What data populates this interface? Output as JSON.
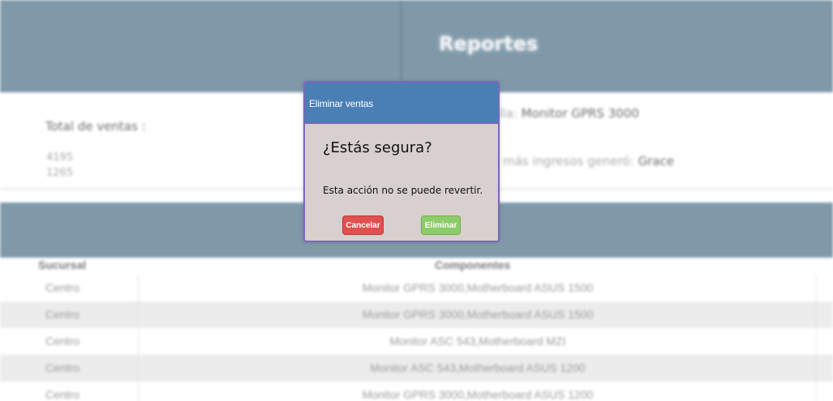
{
  "header": {
    "title": "Reportes"
  },
  "stats": {
    "total_label": "Total de ventas :",
    "totals": [
      "4195",
      "1265"
    ],
    "star_prefix": "ella:",
    "star_product": "Monitor GPRS 3000",
    "top_seller_prefix": "e más ingresos generó:",
    "top_seller_name": "Grace"
  },
  "table": {
    "columns": [
      "Sucursal",
      "Componentes"
    ],
    "rows": [
      {
        "sucursal": "Centro",
        "componentes": "Monitor GPRS 3000,Motherboard ASUS 1500"
      },
      {
        "sucursal": "Centro",
        "componentes": "Monitor GPRS 3000,Motherboard ASUS 1500"
      },
      {
        "sucursal": "Centro",
        "componentes": "Monitor ASC 543,Motherboard MZI"
      },
      {
        "sucursal": "Centro",
        "componentes": "Monitor ASC 543,Motherboard ASUS 1200"
      },
      {
        "sucursal": "Centro",
        "componentes": "Monitor GPRS 3000,Motherboard ASUS 1200"
      }
    ]
  },
  "modal": {
    "title": "Eliminar ventas",
    "question": "¿Estás segura?",
    "message": "Esta acción no se puede revertir.",
    "cancel_label": "Cancelar",
    "confirm_label": "Eliminar"
  },
  "colors": {
    "header_bg": "#7f99a9",
    "modal_header_bg": "#4a7fb5",
    "modal_body_bg": "#d8cfcf",
    "modal_border": "#7b68b8",
    "cancel_button": "#e14f4f",
    "confirm_button": "#8ecb6a"
  }
}
